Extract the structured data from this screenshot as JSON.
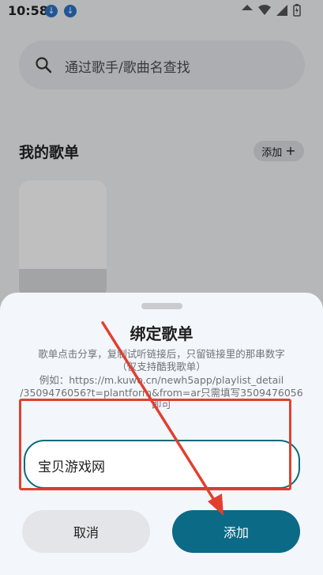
{
  "status_bar": {
    "time": "10:58"
  },
  "search": {
    "placeholder": "通过歌手/歌曲名查找"
  },
  "playlists": {
    "title": "我的歌单",
    "add_label": "添加"
  },
  "sheet": {
    "title": "绑定歌单",
    "hint_lines": [
      "歌单点击分享，复制试听链接后，只留链接里的那串数字",
      "（仅支持酷我歌单）",
      "例如：https://m.kuwo.cn/newh5app/playlist_detail",
      "/3509476056?t=plantform&from=ar只需填写3509476056",
      "即可"
    ],
    "input_value": "宝贝游戏网",
    "cancel_label": "取消",
    "confirm_label": "添加"
  },
  "colors": {
    "accent": "#0b6a86",
    "annotation": "#e0402e"
  }
}
